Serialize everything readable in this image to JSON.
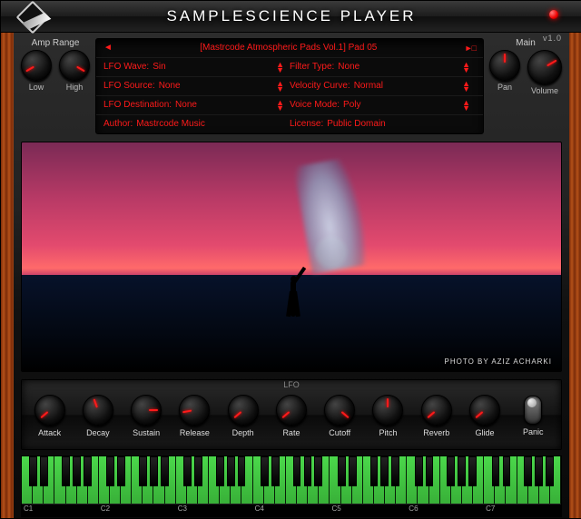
{
  "app": {
    "title": "SAMPLESCIENCE PLAYER",
    "version": "v1.0"
  },
  "amp_range": {
    "label": "Amp Range",
    "low": "Low",
    "high": "High"
  },
  "main": {
    "label": "Main",
    "pan": "Pan",
    "volume": "Volume"
  },
  "browser": {
    "preset": "[Mastrcode Atmospheric Pads Vol.1] Pad 05",
    "prev": "◄",
    "next": "►□",
    "lfo_wave_lab": "LFO Wave:",
    "lfo_wave_val": "Sin",
    "filter_type_lab": "Filter Type:",
    "filter_type_val": "None",
    "lfo_source_lab": "LFO Source:",
    "lfo_source_val": "None",
    "vel_curve_lab": "Velocity Curve:",
    "vel_curve_val": "Normal",
    "lfo_dest_lab": "LFO Destination:",
    "lfo_dest_val": "None",
    "voice_mode_lab": "Voice Mode:",
    "voice_mode_val": "Poly",
    "author_lab": "Author:",
    "author_val": "Mastrcode Music",
    "license_lab": "License:",
    "license_val": "Public Domain"
  },
  "artwork": {
    "credit": "Photo by Aziz Acharki"
  },
  "lfo_label": "LFO",
  "knobs": [
    {
      "name": "attack-knob",
      "label": "Attack",
      "rot": -130
    },
    {
      "name": "decay-knob",
      "label": "Decay",
      "rot": -20
    },
    {
      "name": "sustain-knob",
      "label": "Sustain",
      "rot": 90
    },
    {
      "name": "release-knob",
      "label": "Release",
      "rot": -100
    },
    {
      "name": "depth-knob",
      "label": "Depth",
      "rot": -130
    },
    {
      "name": "rate-knob",
      "label": "Rate",
      "rot": -130
    },
    {
      "name": "cutoff-knob",
      "label": "Cutoff",
      "rot": 130
    },
    {
      "name": "pitch-knob",
      "label": "Pitch",
      "rot": 0
    },
    {
      "name": "reverb-knob",
      "label": "Reverb",
      "rot": -130
    },
    {
      "name": "glide-knob",
      "label": "Glide",
      "rot": -130
    }
  ],
  "panic": {
    "label": "Panic"
  },
  "keyboard": {
    "octaves": [
      "C1",
      "C2",
      "C3",
      "C4",
      "C5",
      "C6",
      "C7"
    ]
  }
}
